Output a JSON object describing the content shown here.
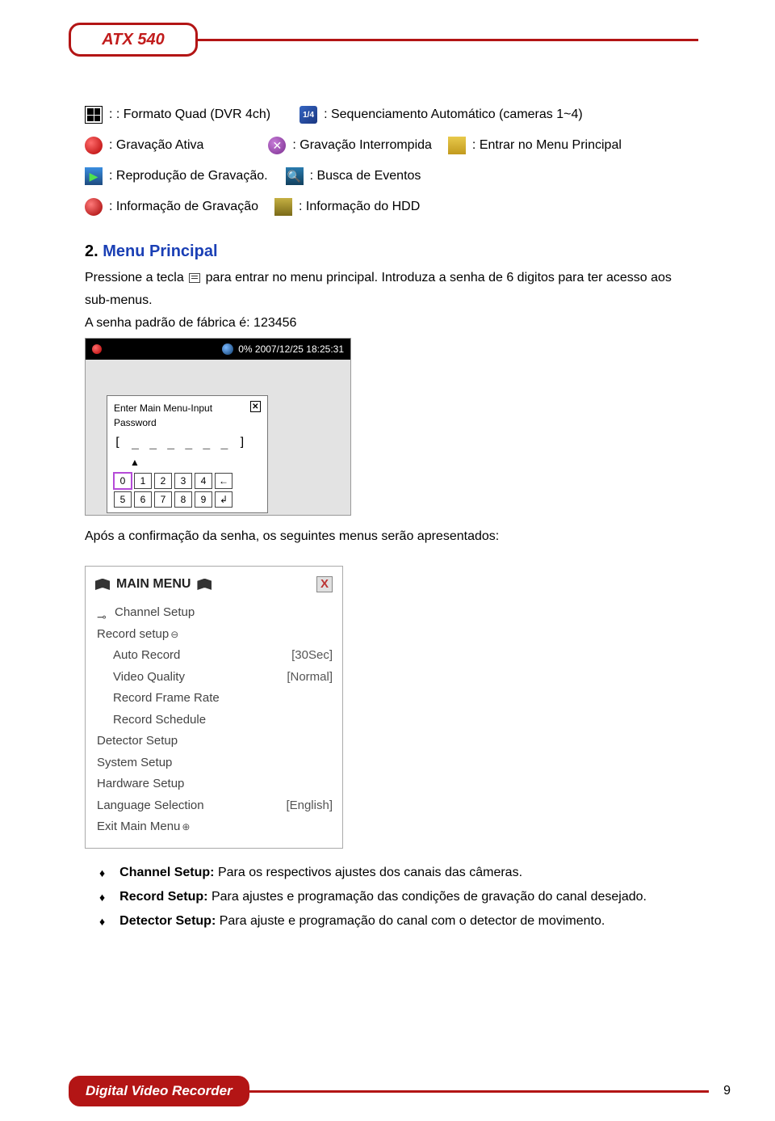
{
  "header": {
    "title": "ATX 540"
  },
  "icons": {
    "quad": ": : Formato Quad (DVR 4ch)",
    "seq": ": Sequenciamento Automático (cameras 1~4)",
    "rec_on": ": Gravação Ativa",
    "rec_off": ": Gravação Interrompida",
    "menu_enter": ": Entrar no Menu Principal",
    "playback": ": Reprodução de Gravação.",
    "events": ": Busca de Eventos",
    "rec_info": ": Informação de Gravação",
    "hdd_info": ": Informação do HDD"
  },
  "section2": {
    "number": "2.",
    "title": "Menu Principal",
    "line1a": "Pressione a tecla",
    "line1b": "para entrar no menu principal. Introduza a senha de 6 digitos para ter acesso aos",
    "line2": "sub-menus.",
    "line3": "A senha padrão de fábrica é: 123456",
    "after_pw": "Após a confirmação da senha, os seguintes menus serão apresentados:"
  },
  "pw_shot": {
    "status": "0%  2007/12/25  18:25:31",
    "dialog_title": "Enter Main Menu-Input Password",
    "field": "[ _ _ _ _ _ _ ]",
    "keys_row1": [
      "0",
      "1",
      "2",
      "3",
      "4",
      "←"
    ],
    "keys_row2": [
      "5",
      "6",
      "7",
      "8",
      "9",
      "↲"
    ]
  },
  "menu_shot": {
    "title": "MAIN MENU",
    "items": [
      {
        "label": "Channel Setup",
        "cls": "key"
      },
      {
        "label": "Record setup",
        "cls": "circ"
      },
      {
        "label": "Auto Record",
        "val": "[30Sec]",
        "sub": true
      },
      {
        "label": "Video Quality",
        "val": "[Normal]",
        "sub": true
      },
      {
        "label": "Record Frame Rate",
        "sub": true
      },
      {
        "label": "Record Schedule",
        "sub": true
      },
      {
        "label": "Detector Setup"
      },
      {
        "label": "System Setup"
      },
      {
        "label": "Hardware Setup"
      },
      {
        "label": "Language Selection",
        "val": "[English]"
      },
      {
        "label": "Exit Main Menu",
        "cls": "plus"
      }
    ]
  },
  "bullets": [
    {
      "bold": "Channel Setup:",
      "text": " Para os respectivos ajustes dos canais das câmeras."
    },
    {
      "bold": "Record Setup:",
      "text": " Para ajustes e programação das condições de gravação do canal desejado."
    },
    {
      "bold": "Detector Setup:",
      "text": " Para ajuste e programação do canal com o detector de movimento."
    }
  ],
  "footer": {
    "label": "Digital Video Recorder",
    "page": "9"
  }
}
